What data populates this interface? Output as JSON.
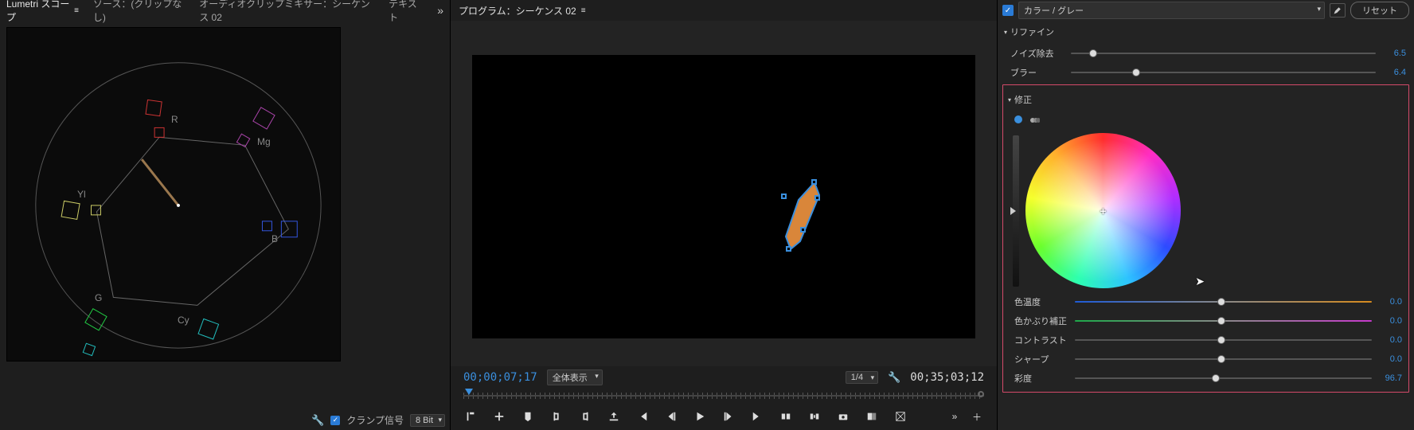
{
  "tabs": {
    "lumetri": "Lumetri スコープ",
    "source": "ソース：(クリップなし)",
    "audiomixer": "オーディオクリップミキサー：シーケンス 02",
    "text": "テキスト"
  },
  "scope": {
    "labels": {
      "R": "R",
      "Mg": "Mg",
      "B": "B",
      "Cy": "Cy",
      "G": "G",
      "Yl": "Yl"
    },
    "clamp": "クランプ信号",
    "bit": "8 Bit"
  },
  "program": {
    "title": "プログラム：シーケンス 02",
    "cur": "00;00;07;17",
    "fit": "全体表示",
    "zoom": "1/4",
    "dur": "00;35;03;12"
  },
  "right": {
    "colorgray": "カラー / グレー",
    "reset": "リセット",
    "refine": "リファイン",
    "noise": "ノイズ除去",
    "noise_v": "6.5",
    "blur": "ブラー",
    "blur_v": "6.4",
    "correction": "修正",
    "temp": "色温度",
    "temp_v": "0.0",
    "tint": "色かぶり補正",
    "tint_v": "0.0",
    "contrast": "コントラスト",
    "contrast_v": "0.0",
    "sharp": "シャープ",
    "sharp_v": "0.0",
    "sat": "彩度",
    "sat_v": "96.7"
  }
}
